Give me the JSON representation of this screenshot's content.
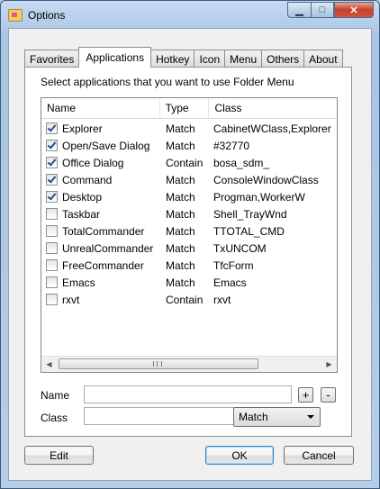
{
  "window": {
    "title": "Options"
  },
  "tabs": [
    {
      "label": "Favorites"
    },
    {
      "label": "Applications"
    },
    {
      "label": "Hotkey"
    },
    {
      "label": "Icon"
    },
    {
      "label": "Menu"
    },
    {
      "label": "Others"
    },
    {
      "label": "About"
    }
  ],
  "active_tab": "Applications",
  "instruction": "Select applications that you want to use Folder Menu",
  "list": {
    "columns": {
      "name": "Name",
      "type": "Type",
      "class": "Class"
    },
    "rows": [
      {
        "name": "Explorer",
        "type": "Match",
        "class": "CabinetWClass,Explorer",
        "checked": true
      },
      {
        "name": "Open/Save Dialog",
        "type": "Match",
        "class": "#32770",
        "checked": true
      },
      {
        "name": "Office Dialog",
        "type": "Contain",
        "class": "bosa_sdm_",
        "checked": true
      },
      {
        "name": "Command",
        "type": "Match",
        "class": "ConsoleWindowClass",
        "checked": true
      },
      {
        "name": "Desktop",
        "type": "Match",
        "class": "Progman,WorkerW",
        "checked": true
      },
      {
        "name": "Taskbar",
        "type": "Match",
        "class": "Shell_TrayWnd",
        "checked": false
      },
      {
        "name": "TotalCommander",
        "type": "Match",
        "class": "TTOTAL_CMD",
        "checked": false
      },
      {
        "name": "UnrealCommander",
        "type": "Match",
        "class": "TxUNCOM",
        "checked": false
      },
      {
        "name": "FreeCommander",
        "type": "Match",
        "class": "TfcForm",
        "checked": false
      },
      {
        "name": "Emacs",
        "type": "Match",
        "class": "Emacs",
        "checked": false
      },
      {
        "name": "rxvt",
        "type": "Contain",
        "class": "rxvt",
        "checked": false
      }
    ]
  },
  "form": {
    "name_label": "Name",
    "name_value": "",
    "class_label": "Class",
    "class_value": "",
    "add_label": "+",
    "remove_label": "-",
    "match_type": "Match"
  },
  "buttons": {
    "edit": "Edit",
    "ok": "OK",
    "cancel": "Cancel"
  }
}
